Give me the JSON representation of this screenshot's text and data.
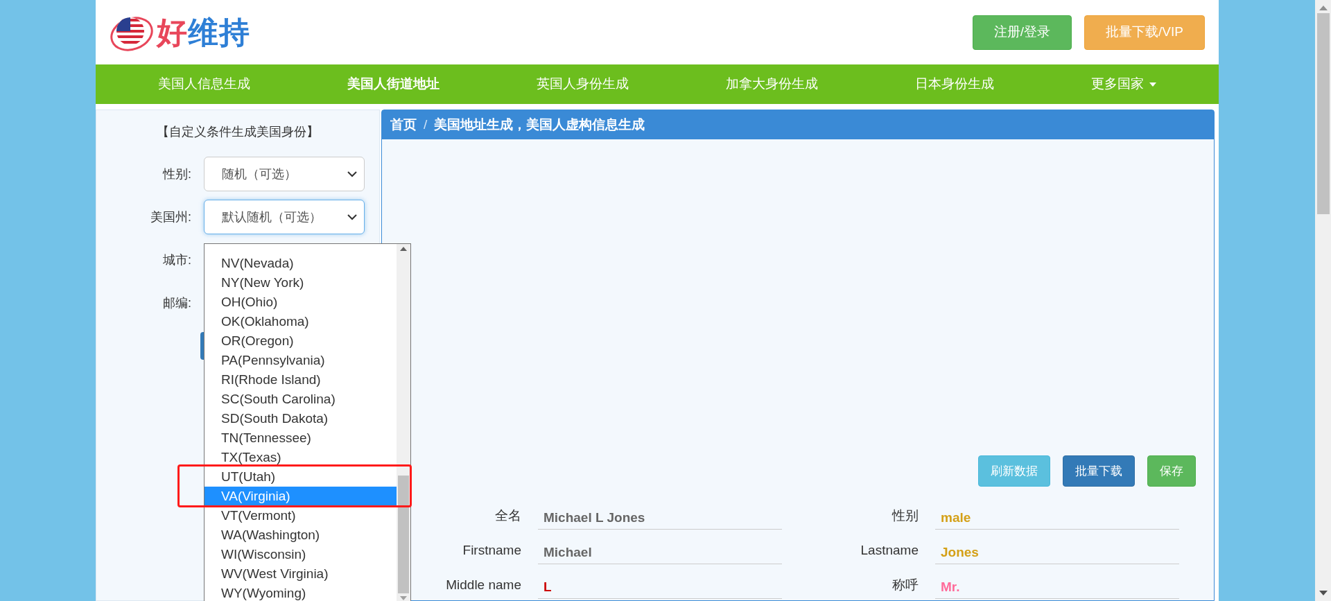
{
  "logo": {
    "parts": [
      {
        "text": "好",
        "color": "#e8465a"
      },
      {
        "text": "维持",
        "color": "#2e7fd6"
      }
    ]
  },
  "header_buttons": [
    {
      "label": "注册/登录",
      "kind": "success"
    },
    {
      "label": "批量下载/VIP",
      "kind": "warning"
    }
  ],
  "nav": [
    {
      "label": "美国人信息生成",
      "selected": false,
      "caret": false
    },
    {
      "label": "美国人街道地址",
      "selected": true,
      "caret": false
    },
    {
      "label": "英国人身份生成",
      "selected": false,
      "caret": false
    },
    {
      "label": "加拿大身份生成",
      "selected": false,
      "caret": false
    },
    {
      "label": "日本身份生成",
      "selected": false,
      "caret": false
    },
    {
      "label": "更多国家",
      "selected": false,
      "caret": true
    }
  ],
  "sidebar": {
    "title": "【自定义条件生成美国身份】",
    "fields": [
      {
        "label": "性别:",
        "value": "随机（可选）",
        "focused": false
      },
      {
        "label": "美国州:",
        "value": "默认随机（可选）",
        "focused": true
      },
      {
        "label": "城市:"
      },
      {
        "label": "邮编:"
      }
    ],
    "dropdown": [
      {
        "label": "NV(Nevada)",
        "selected": false
      },
      {
        "label": "NY(New York)",
        "selected": false
      },
      {
        "label": "OH(Ohio)",
        "selected": false
      },
      {
        "label": "OK(Oklahoma)",
        "selected": false
      },
      {
        "label": "OR(Oregon)",
        "selected": false
      },
      {
        "label": "PA(Pennsylvania)",
        "selected": false
      },
      {
        "label": "RI(Rhode Island)",
        "selected": false
      },
      {
        "label": "SC(South Carolina)",
        "selected": false
      },
      {
        "label": "SD(South Dakota)",
        "selected": false
      },
      {
        "label": "TN(Tennessee)",
        "selected": false
      },
      {
        "label": "TX(Texas)",
        "selected": false
      },
      {
        "label": "UT(Utah)",
        "selected": false
      },
      {
        "label": "VA(Virginia)",
        "selected": true
      },
      {
        "label": "VT(Vermont)",
        "selected": false
      },
      {
        "label": "WA(Washington)",
        "selected": false
      },
      {
        "label": "WI(Wisconsin)",
        "selected": false
      },
      {
        "label": "WV(West Virginia)",
        "selected": false
      },
      {
        "label": "WY(Wyoming)",
        "selected": false
      }
    ]
  },
  "breadcrumb": [
    "首页",
    "/",
    "美国地址生成，美国人虚构信息生成"
  ],
  "actions": [
    {
      "label": "刷新数据",
      "kind": "info"
    },
    {
      "label": "批量下载",
      "kind": "primary"
    },
    {
      "label": "保存",
      "kind": "success"
    }
  ],
  "details": [
    {
      "label": "全名",
      "value": "Michael L Jones",
      "color": "#666666"
    },
    {
      "label": "性别",
      "value": "male",
      "color": "#d4a017"
    },
    {
      "label": "Firstname",
      "value": "Michael",
      "color": "#666666"
    },
    {
      "label": "Lastname",
      "value": "Jones",
      "color": "#d4a017"
    },
    {
      "label": "Middle name",
      "value": "L",
      "color": "#cc0000"
    },
    {
      "label": "称呼",
      "value": "Mr.",
      "color": "#ff6b9a"
    }
  ]
}
